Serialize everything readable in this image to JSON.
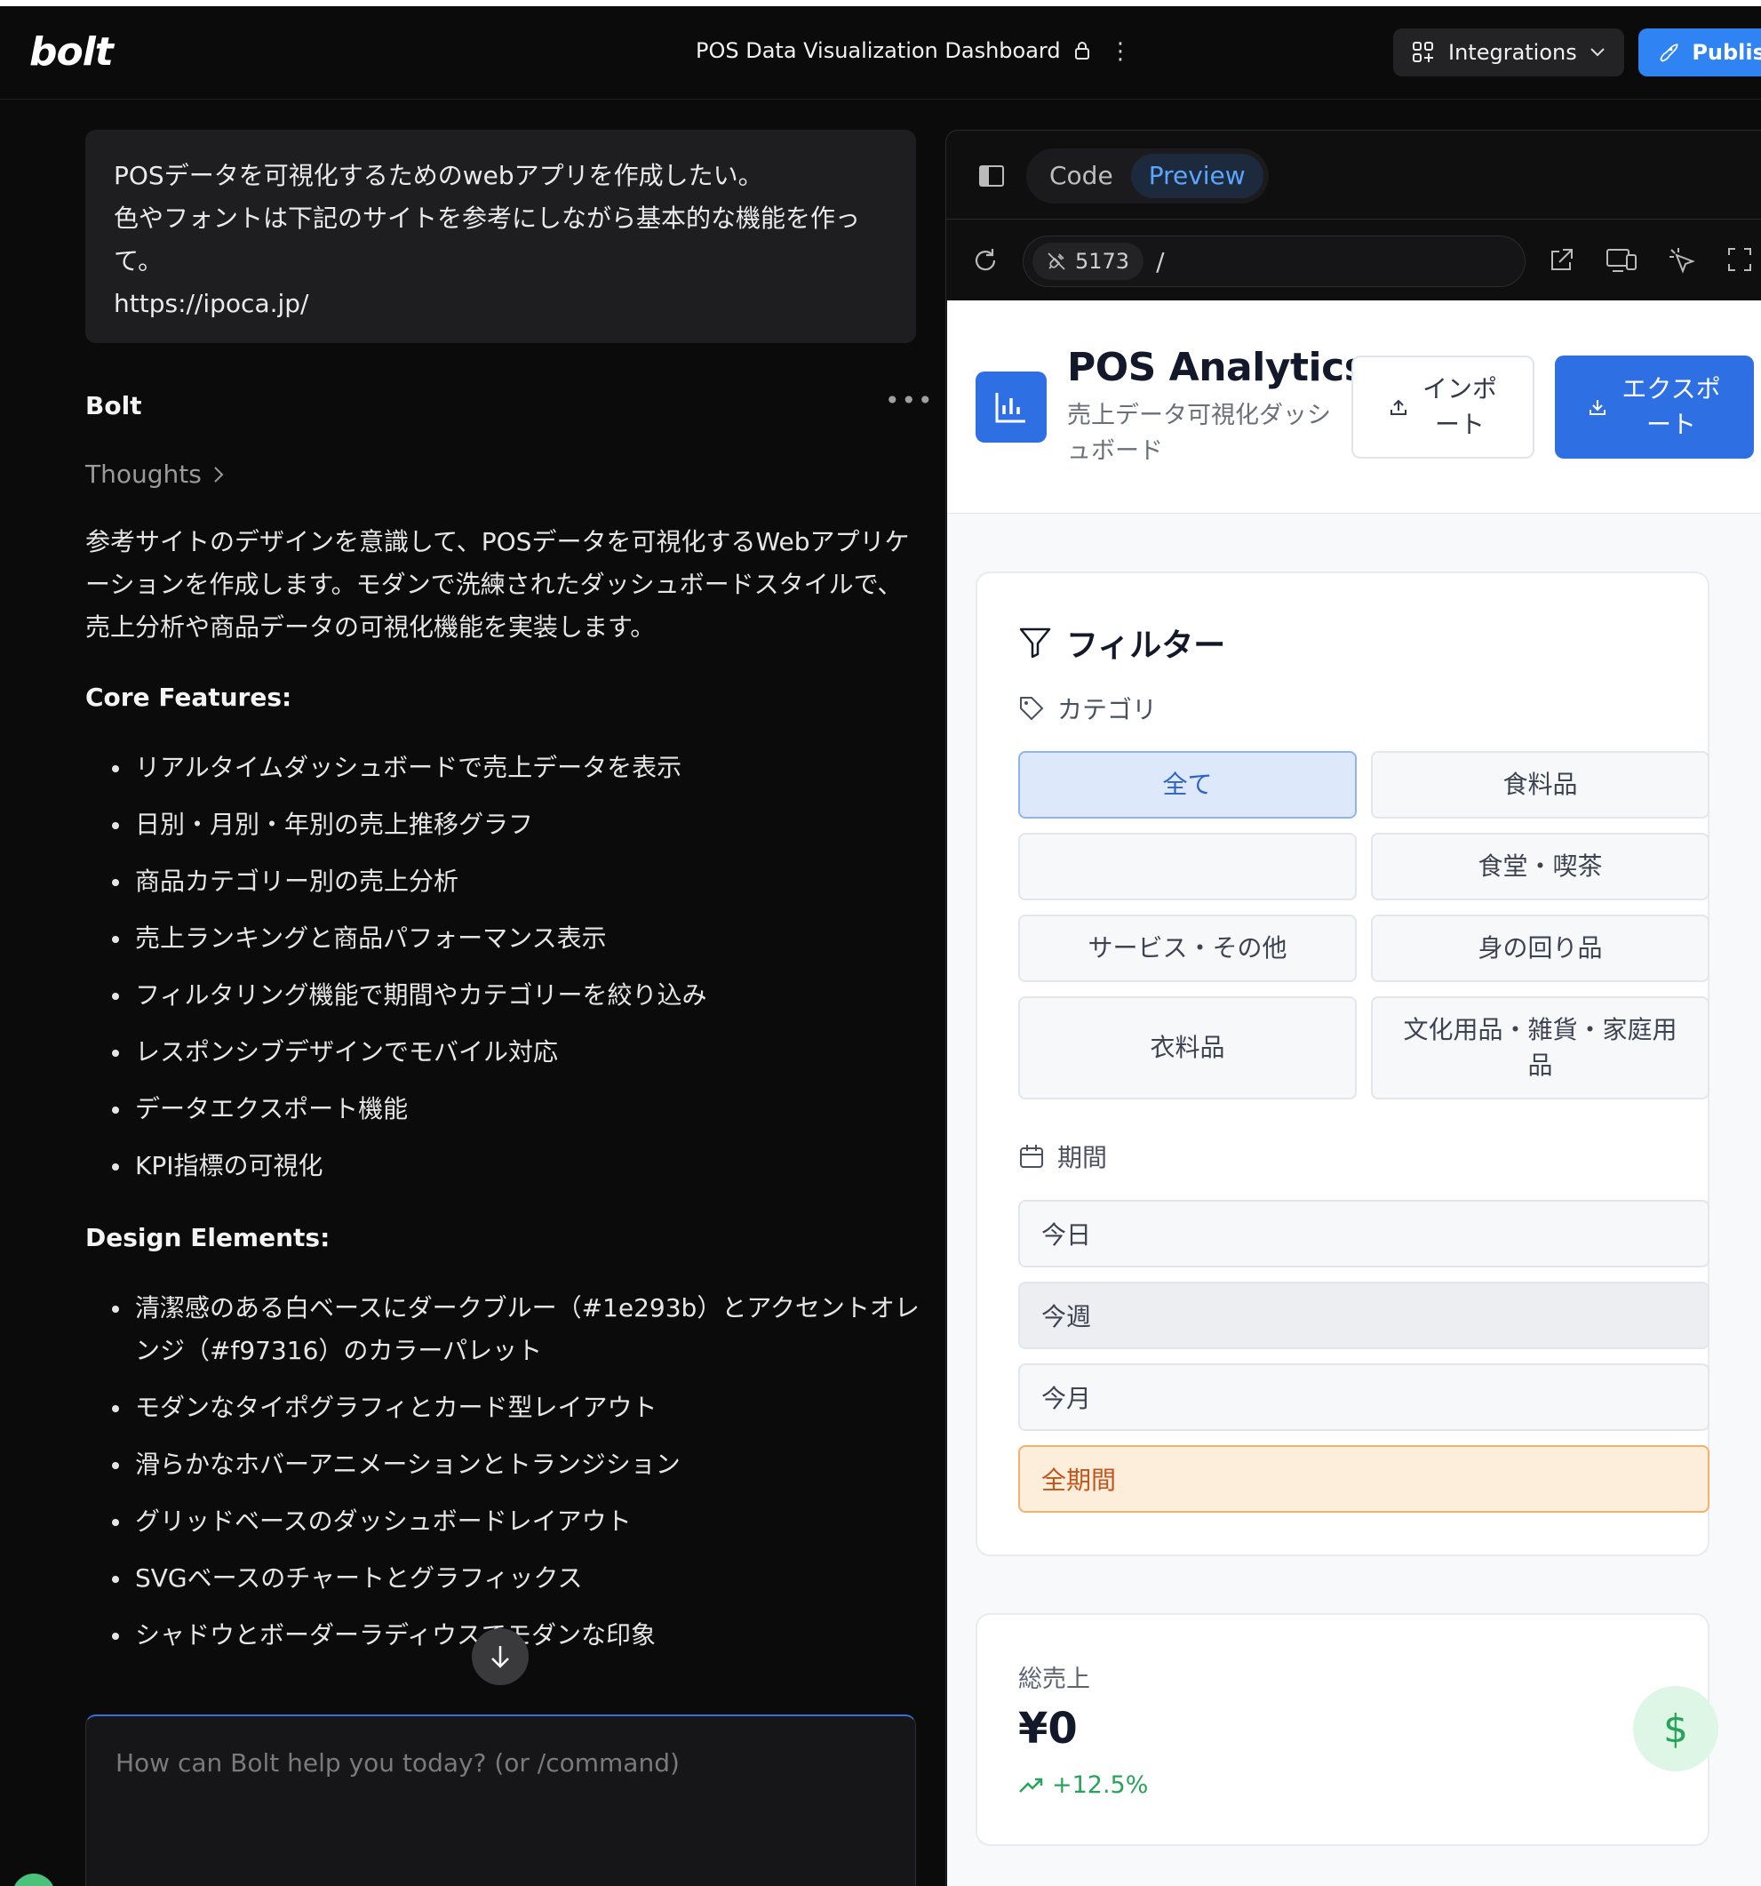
{
  "header": {
    "logo": "bolt",
    "project_title": "POS Data Visualization Dashboard",
    "integrations_label": "Integrations",
    "publish_label": "Publish"
  },
  "chat": {
    "user_message_lines": [
      "POSデータを可視化するためのwebアプリを作成したい。",
      "色やフォントは下記のサイトを参考にしながら基本的な機能を作っ",
      "て。",
      "https://ipoca.jp/"
    ],
    "assistant_name": "Bolt",
    "more_label": "•••",
    "thoughts_label": "Thoughts",
    "intro_lines": [
      "参考サイトのデザインを意識して、POSデータを可視化するWebアプリケ",
      "ーションを作成します。モダンで洗練されたダッシュボードスタイルで、",
      "売上分析や商品データの可視化機能を実装します。"
    ],
    "core_title": "Core Features:",
    "core_features": [
      "リアルタイムダッシュボードで売上データを表示",
      "日別・月別・年別の売上推移グラフ",
      "商品カテゴリー別の売上分析",
      "売上ランキングと商品パフォーマンス表示",
      "フィルタリング機能で期間やカテゴリーを絞り込み",
      "レスポンシブデザインでモバイル対応",
      "データエクスポート機能",
      "KPI指標の可視化"
    ],
    "design_title": "Design Elements:",
    "design_elements": [
      "清潔感のある白ベースにダークブルー（#1e293b）とアクセントオレ",
      "ンジ（#f97316）のカラーパレット",
      "モダンなタイポグラフィとカード型レイアウト",
      "滑らかなホバーアニメーションとトランジション",
      "グリッドベースのダッシュボードレイアウト",
      "SVGベースのチャートとグラフィックス",
      "シャドウとボーダーラディウスでモダンな印象"
    ],
    "composer_placeholder": "How can Bolt help you today? (or /command)"
  },
  "preview": {
    "tab_code": "Code",
    "tab_preview": "Preview",
    "port": "5173",
    "path": "/"
  },
  "app": {
    "title": "POS Analytics",
    "subtitle_lines": [
      "売上データ可視化ダッシ",
      "ュボード"
    ],
    "import_lines": [
      "インポ",
      "ート"
    ],
    "export_lines": [
      "エクスポ",
      "ート"
    ],
    "filter_title": "フィルター",
    "category_label": "カテゴリ",
    "categories": [
      "全て",
      "食料品",
      "",
      "食堂・喫茶",
      "サービス・その他",
      "身の回り品",
      "衣料品",
      "文化用品・雑貨・家庭用品"
    ],
    "active_category": "全て",
    "period_label": "期間",
    "periods": [
      "今日",
      "今週",
      "今月",
      "全期間"
    ],
    "active_period": "全期間",
    "total_sales_label": "総売上",
    "total_sales_value": "¥0",
    "total_sales_change": "+12.5%",
    "currency_symbol": "$"
  },
  "colors": {
    "accent_blue": "#2f6fe4",
    "accent_orange": "#f97316",
    "publish_blue": "#2f83f3",
    "success_green": "#27a35a"
  }
}
